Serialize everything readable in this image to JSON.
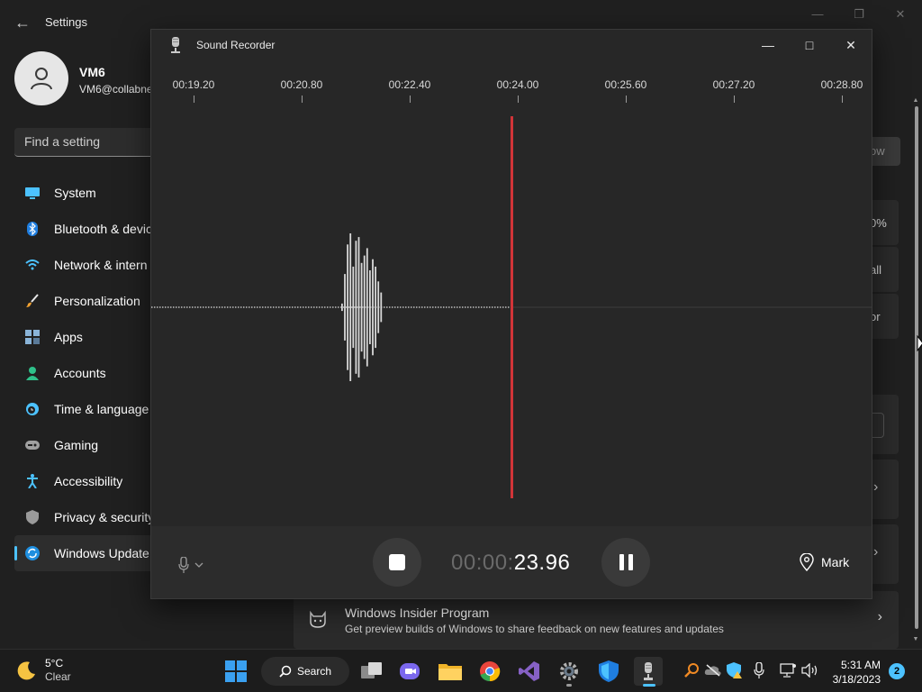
{
  "settings": {
    "title": "Settings",
    "user": {
      "name": "VM6",
      "email": "VM6@collabne"
    },
    "search_placeholder": "Find a setting",
    "nav": [
      {
        "label": "System",
        "icon": "system-icon"
      },
      {
        "label": "Bluetooth & devic",
        "icon": "bluetooth-icon"
      },
      {
        "label": "Network & intern",
        "icon": "network-icon"
      },
      {
        "label": "Personalization",
        "icon": "brush-icon"
      },
      {
        "label": "Apps",
        "icon": "apps-icon"
      },
      {
        "label": "Accounts",
        "icon": "accounts-icon"
      },
      {
        "label": "Time & language",
        "icon": "time-language-icon"
      },
      {
        "label": "Gaming",
        "icon": "gaming-icon"
      },
      {
        "label": "Accessibility",
        "icon": "accessibility-icon"
      },
      {
        "label": "Privacy & security",
        "icon": "shield-icon"
      },
      {
        "label": "Windows Update",
        "icon": "windows-update-icon",
        "active": true
      }
    ],
    "partial_labels": {
      "button": "ow",
      "percent": "0%",
      "all": "all",
      "or": "or"
    },
    "insider": {
      "title": "Windows Insider Program",
      "description": "Get preview builds of Windows to share feedback on new features and updates"
    }
  },
  "recorder": {
    "title": "Sound Recorder",
    "timeline": [
      "00:19.20",
      "00:20.80",
      "00:22.40",
      "00:24.00",
      "00:25.60",
      "00:27.20",
      "00:28.80"
    ],
    "waveform_amplitudes": [
      0.05,
      0.45,
      0.85,
      1.0,
      0.55,
      0.9,
      0.95,
      0.6,
      0.7,
      0.8,
      0.5,
      0.65,
      0.55,
      0.35,
      0.2
    ],
    "elapsed_dim": "00:00:",
    "elapsed_main": "23.96",
    "mark_label": "Mark",
    "accent_color": "#d13438"
  },
  "taskbar": {
    "weather": {
      "temp": "5°C",
      "desc": "Clear"
    },
    "search_label": "Search",
    "time": "5:31 AM",
    "date": "3/18/2023",
    "notifications": "2"
  }
}
